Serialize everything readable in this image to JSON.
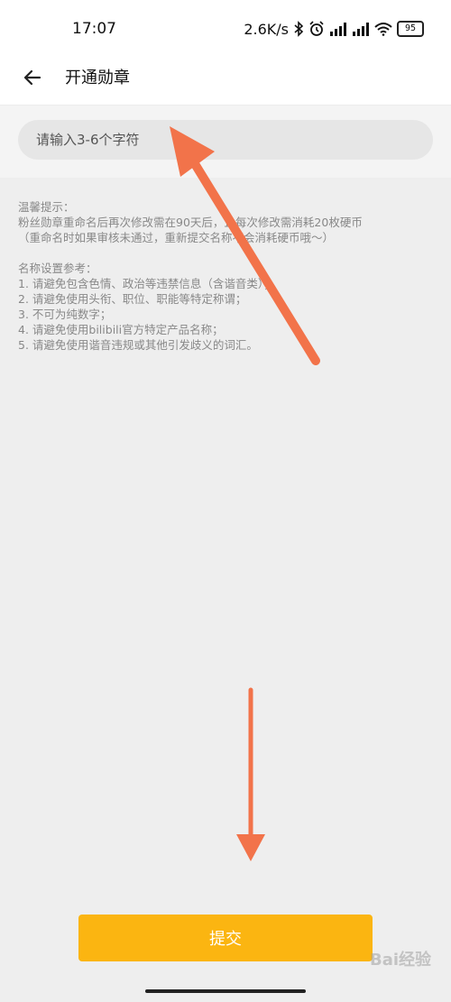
{
  "status_bar": {
    "time": "17:07",
    "network_speed": "2.6K/s",
    "battery_level": "95",
    "icons": [
      "bluetooth-icon",
      "alarm-icon",
      "signal-icon",
      "signal-icon",
      "wifi-icon",
      "battery-icon"
    ]
  },
  "header": {
    "title": "开通勋章",
    "back_icon": "arrow-left-icon"
  },
  "input": {
    "placeholder": "请输入3-6个字符",
    "value": ""
  },
  "tips": {
    "heading": "温馨提示：",
    "lines": [
      "粉丝勋章重命名后再次修改需在90天后，且每次修改需消耗20枚硬币",
      "（重命名时如果审核未通过，重新提交名称不会消耗硬币哦～）"
    ],
    "reference_heading": "名称设置参考：",
    "rules": [
      "1. 请避免包含色情、政治等违禁信息（含谐音类）；",
      "2. 请避免使用头衔、职位、职能等特定称谓；",
      "3. 不可为纯数字；",
      "4. 请避免使用bilibili官方特定产品名称；",
      "5. 请避免使用谐音违规或其他引发歧义的词汇。"
    ]
  },
  "submit": {
    "label": "提交"
  },
  "watermark": "Bai经验",
  "colors": {
    "accent": "#fbb511",
    "annotation_arrow": "#f2734a"
  }
}
